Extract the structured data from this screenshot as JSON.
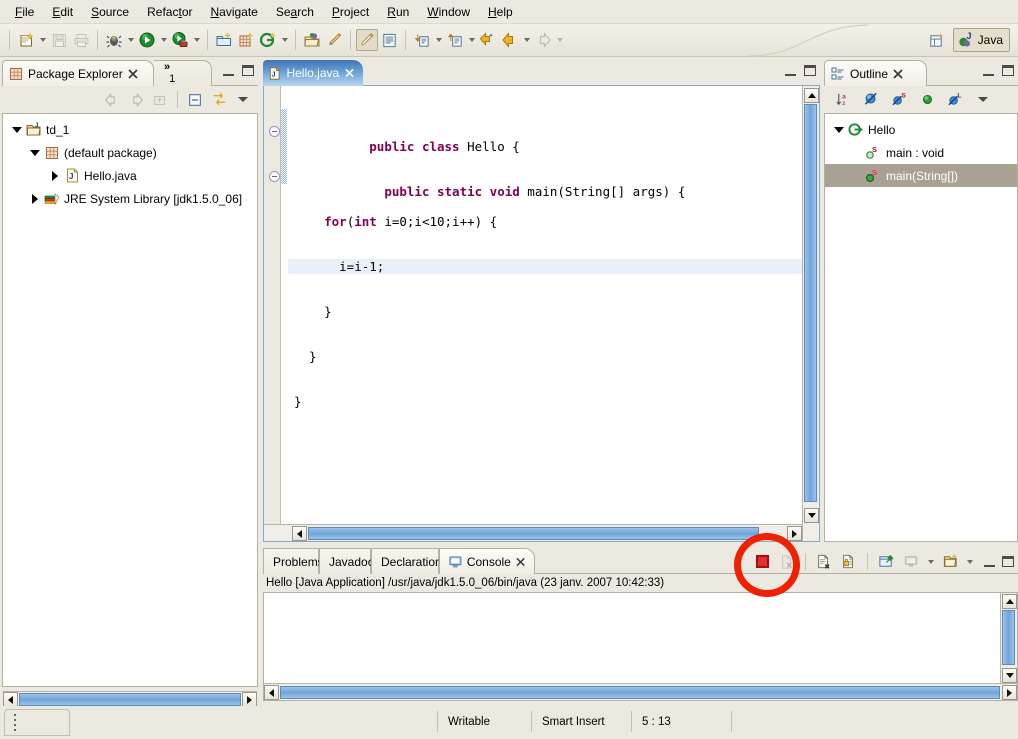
{
  "menubar": {
    "items": [
      {
        "label": "File",
        "mnemonic": "F"
      },
      {
        "label": "Edit",
        "mnemonic": "E"
      },
      {
        "label": "Source",
        "mnemonic": "S"
      },
      {
        "label": "Refactor",
        "mnemonic": "t"
      },
      {
        "label": "Navigate",
        "mnemonic": "N"
      },
      {
        "label": "Search",
        "mnemonic": "a"
      },
      {
        "label": "Project",
        "mnemonic": "P"
      },
      {
        "label": "Run",
        "mnemonic": "R"
      },
      {
        "label": "Window",
        "mnemonic": "W"
      },
      {
        "label": "Help",
        "mnemonic": "H"
      }
    ]
  },
  "toolbar": {
    "buttons": [
      {
        "name": "new-wizard-button",
        "icon": "new-file-icon",
        "dropdown": true,
        "enabled": true
      },
      {
        "name": "save-button",
        "icon": "save-disk-icon",
        "dropdown": false,
        "enabled": false
      },
      {
        "name": "print-button",
        "icon": "printer-icon",
        "dropdown": false,
        "enabled": false
      },
      {
        "name": "debug-button",
        "icon": "debug-bug-icon",
        "dropdown": true,
        "enabled": true
      },
      {
        "name": "run-button",
        "icon": "run-play-icon",
        "dropdown": true,
        "enabled": true
      },
      {
        "name": "external-tools-button",
        "icon": "external-tools-icon",
        "dropdown": true,
        "enabled": true
      },
      {
        "name": "new-java-project-button",
        "icon": "new-java-project-icon",
        "dropdown": false,
        "enabled": true
      },
      {
        "name": "new-package-button",
        "icon": "new-package-icon",
        "dropdown": false,
        "enabled": true
      },
      {
        "name": "new-class-button",
        "icon": "new-class-icon",
        "dropdown": true,
        "enabled": true
      },
      {
        "name": "open-type-button",
        "icon": "open-type-icon",
        "dropdown": false,
        "enabled": true
      },
      {
        "name": "search-button",
        "icon": "search-pencil-icon",
        "dropdown": false,
        "enabled": true
      },
      {
        "name": "toggle-mark-occurrences-button",
        "icon": "highlight-pen-icon",
        "dropdown": false,
        "enabled": true,
        "pressed": true
      },
      {
        "name": "show-whitespace-button",
        "icon": "document-lines-icon",
        "dropdown": false,
        "enabled": true
      },
      {
        "name": "next-annotation-button",
        "icon": "next-annotation-icon",
        "dropdown": true,
        "enabled": true
      },
      {
        "name": "previous-annotation-button",
        "icon": "previous-annotation-icon",
        "dropdown": true,
        "enabled": true
      },
      {
        "name": "last-edit-location-button",
        "icon": "last-edit-arrow-icon",
        "dropdown": false,
        "enabled": true
      },
      {
        "name": "back-button",
        "icon": "back-arrow-icon",
        "dropdown": true,
        "enabled": true
      },
      {
        "name": "forward-button",
        "icon": "forward-arrow-icon",
        "dropdown": true,
        "enabled": false
      }
    ],
    "open_perspective_label": "",
    "perspective": {
      "label": "Java",
      "icon": "java-perspective-icon"
    }
  },
  "package_explorer": {
    "tab_label": "Package Explorer",
    "tab_icon": "package-explorer-icon",
    "overflow_chevron": "»",
    "overflow_count": "1",
    "toolbar": [
      {
        "name": "back-button",
        "icon": "back-arrow-icon",
        "enabled": false
      },
      {
        "name": "forward-button",
        "icon": "forward-arrow-icon",
        "enabled": false
      },
      {
        "name": "up-button",
        "icon": "go-up-icon",
        "enabled": false
      },
      {
        "name": "collapse-all-button",
        "icon": "collapse-all-icon",
        "enabled": true
      },
      {
        "name": "link-with-editor-button",
        "icon": "link-editor-icon",
        "enabled": true
      },
      {
        "name": "view-menu-button",
        "icon": "chevron-down-icon",
        "enabled": true
      }
    ],
    "tree": [
      {
        "label": "td_1",
        "icon": "java-project-icon",
        "twisty": "open",
        "indent": 0
      },
      {
        "label": "(default package)",
        "icon": "package-icon",
        "twisty": "open",
        "indent": 1
      },
      {
        "label": "Hello.java",
        "icon": "java-file-icon",
        "twisty": "closed",
        "indent": 2
      },
      {
        "label": "JRE System Library [jdk1.5.0_06]",
        "icon": "library-icon",
        "twisty": "closed",
        "indent": 1
      }
    ]
  },
  "editor": {
    "tab_label": "Hello.java",
    "tab_icon": "java-file-icon",
    "close_icon": "close-icon",
    "lines": [
      {
        "segments": [
          {
            "t": "public class",
            "k": true
          },
          {
            "t": " Hello {",
            "k": false
          }
        ],
        "fold": true,
        "highlight": false,
        "changed": false
      },
      {
        "segments": [
          {
            "t": "  public static void",
            "k": true
          },
          {
            "t": " main(String[] args) {",
            "k": false
          }
        ],
        "fold": true,
        "highlight": false,
        "changed": true
      },
      {
        "segments": [
          {
            "t": "    for",
            "k": true
          },
          {
            "t": "(",
            "k": false
          },
          {
            "t": "int",
            "k": true
          },
          {
            "t": " i=0;i<10;i++) {",
            "k": false
          }
        ],
        "fold": false,
        "highlight": false,
        "changed": true
      },
      {
        "segments": [
          {
            "t": "      i=i-1;",
            "k": false
          }
        ],
        "fold": false,
        "highlight": true,
        "changed": true
      },
      {
        "segments": [
          {
            "t": "    }",
            "k": false
          }
        ],
        "fold": false,
        "highlight": false,
        "changed": true
      },
      {
        "segments": [
          {
            "t": "  }",
            "k": false
          }
        ],
        "fold": false,
        "highlight": false,
        "changed": true
      },
      {
        "segments": [
          {
            "t": "}",
            "k": false
          }
        ],
        "fold": false,
        "highlight": false,
        "changed": false
      }
    ]
  },
  "outline": {
    "tab_label": "Outline",
    "tab_icon": "outline-icon",
    "close_icon": "close-icon",
    "toolbar": [
      {
        "name": "sort-button",
        "icon": "sort-az-icon",
        "enabled": true
      },
      {
        "name": "hide-fields-button",
        "icon": "hide-fields-icon",
        "enabled": true
      },
      {
        "name": "hide-static-button",
        "icon": "hide-static-icon",
        "enabled": true
      },
      {
        "name": "hide-nonpublic-button",
        "icon": "hide-nonpublic-icon",
        "enabled": true
      },
      {
        "name": "hide-local-types-button",
        "icon": "hide-local-types-icon",
        "enabled": true
      },
      {
        "name": "view-menu-button",
        "icon": "chevron-down-icon",
        "enabled": true
      }
    ],
    "tree": [
      {
        "label": "Hello",
        "icon": "java-class-icon",
        "twisty": "open",
        "indent": 0,
        "selected": false
      },
      {
        "label": "main : void",
        "icon": "method-static-icon",
        "twisty": "none",
        "indent": 1,
        "selected": false
      },
      {
        "label": "main(String[])",
        "icon": "method-static-icon",
        "twisty": "none",
        "indent": 1,
        "selected": true
      }
    ]
  },
  "bottom_panel": {
    "tabs": [
      {
        "label": "Problems",
        "active": false,
        "icon": null
      },
      {
        "label": "Javadoc",
        "active": false,
        "icon": null
      },
      {
        "label": "Declaration",
        "active": false,
        "icon": null
      },
      {
        "label": "Console",
        "active": true,
        "icon": "console-icon",
        "close_icon": "close-icon"
      }
    ],
    "status_line": "Hello [Java Application] /usr/java/jdk1.5.0_06/bin/java (23 janv. 2007 10:42:33)",
    "output": "",
    "toolbar": [
      {
        "name": "terminate-button",
        "icon": "stop-square-icon",
        "enabled": true,
        "color": "#e03030"
      },
      {
        "name": "remove-launch-button",
        "icon": "remove-launch-icon",
        "enabled": false
      },
      {
        "name": "clear-console-button",
        "icon": "clear-console-icon",
        "enabled": true
      },
      {
        "name": "scroll-lock-button",
        "icon": "scroll-lock-icon",
        "enabled": true
      },
      {
        "name": "pin-console-button",
        "icon": "pin-console-icon",
        "enabled": true
      },
      {
        "name": "display-selected-console-button",
        "icon": "display-console-icon",
        "enabled": true,
        "dropdown": true
      },
      {
        "name": "open-console-button",
        "icon": "open-console-icon",
        "enabled": true,
        "dropdown": true
      }
    ]
  },
  "statusbar": {
    "fields": [
      "Writable",
      "Smart Insert",
      "5 : 13"
    ]
  },
  "annotation": {
    "shape": "circle",
    "color": "#f02000",
    "target": "terminate-button"
  }
}
